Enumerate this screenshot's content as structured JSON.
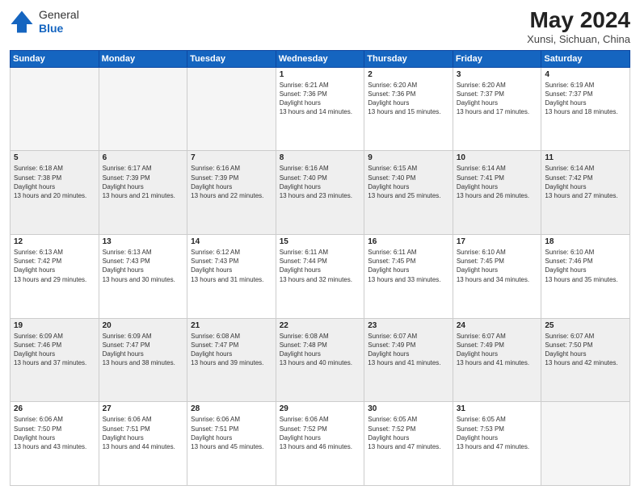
{
  "header": {
    "logo_line1": "General",
    "logo_line2": "Blue",
    "title": "May 2024",
    "subtitle": "Xunsi, Sichuan, China"
  },
  "weekdays": [
    "Sunday",
    "Monday",
    "Tuesday",
    "Wednesday",
    "Thursday",
    "Friday",
    "Saturday"
  ],
  "weeks": [
    [
      {
        "day": "",
        "empty": true
      },
      {
        "day": "",
        "empty": true
      },
      {
        "day": "",
        "empty": true
      },
      {
        "day": "1",
        "sunrise": "6:21 AM",
        "sunset": "7:36 PM",
        "daylight": "13 hours and 14 minutes."
      },
      {
        "day": "2",
        "sunrise": "6:20 AM",
        "sunset": "7:36 PM",
        "daylight": "13 hours and 15 minutes."
      },
      {
        "day": "3",
        "sunrise": "6:20 AM",
        "sunset": "7:37 PM",
        "daylight": "13 hours and 17 minutes."
      },
      {
        "day": "4",
        "sunrise": "6:19 AM",
        "sunset": "7:37 PM",
        "daylight": "13 hours and 18 minutes."
      }
    ],
    [
      {
        "day": "5",
        "sunrise": "6:18 AM",
        "sunset": "7:38 PM",
        "daylight": "13 hours and 20 minutes."
      },
      {
        "day": "6",
        "sunrise": "6:17 AM",
        "sunset": "7:39 PM",
        "daylight": "13 hours and 21 minutes."
      },
      {
        "day": "7",
        "sunrise": "6:16 AM",
        "sunset": "7:39 PM",
        "daylight": "13 hours and 22 minutes."
      },
      {
        "day": "8",
        "sunrise": "6:16 AM",
        "sunset": "7:40 PM",
        "daylight": "13 hours and 23 minutes."
      },
      {
        "day": "9",
        "sunrise": "6:15 AM",
        "sunset": "7:40 PM",
        "daylight": "13 hours and 25 minutes."
      },
      {
        "day": "10",
        "sunrise": "6:14 AM",
        "sunset": "7:41 PM",
        "daylight": "13 hours and 26 minutes."
      },
      {
        "day": "11",
        "sunrise": "6:14 AM",
        "sunset": "7:42 PM",
        "daylight": "13 hours and 27 minutes."
      }
    ],
    [
      {
        "day": "12",
        "sunrise": "6:13 AM",
        "sunset": "7:42 PM",
        "daylight": "13 hours and 29 minutes."
      },
      {
        "day": "13",
        "sunrise": "6:13 AM",
        "sunset": "7:43 PM",
        "daylight": "13 hours and 30 minutes."
      },
      {
        "day": "14",
        "sunrise": "6:12 AM",
        "sunset": "7:43 PM",
        "daylight": "13 hours and 31 minutes."
      },
      {
        "day": "15",
        "sunrise": "6:11 AM",
        "sunset": "7:44 PM",
        "daylight": "13 hours and 32 minutes."
      },
      {
        "day": "16",
        "sunrise": "6:11 AM",
        "sunset": "7:45 PM",
        "daylight": "13 hours and 33 minutes."
      },
      {
        "day": "17",
        "sunrise": "6:10 AM",
        "sunset": "7:45 PM",
        "daylight": "13 hours and 34 minutes."
      },
      {
        "day": "18",
        "sunrise": "6:10 AM",
        "sunset": "7:46 PM",
        "daylight": "13 hours and 35 minutes."
      }
    ],
    [
      {
        "day": "19",
        "sunrise": "6:09 AM",
        "sunset": "7:46 PM",
        "daylight": "13 hours and 37 minutes."
      },
      {
        "day": "20",
        "sunrise": "6:09 AM",
        "sunset": "7:47 PM",
        "daylight": "13 hours and 38 minutes."
      },
      {
        "day": "21",
        "sunrise": "6:08 AM",
        "sunset": "7:47 PM",
        "daylight": "13 hours and 39 minutes."
      },
      {
        "day": "22",
        "sunrise": "6:08 AM",
        "sunset": "7:48 PM",
        "daylight": "13 hours and 40 minutes."
      },
      {
        "day": "23",
        "sunrise": "6:07 AM",
        "sunset": "7:49 PM",
        "daylight": "13 hours and 41 minutes."
      },
      {
        "day": "24",
        "sunrise": "6:07 AM",
        "sunset": "7:49 PM",
        "daylight": "13 hours and 41 minutes."
      },
      {
        "day": "25",
        "sunrise": "6:07 AM",
        "sunset": "7:50 PM",
        "daylight": "13 hours and 42 minutes."
      }
    ],
    [
      {
        "day": "26",
        "sunrise": "6:06 AM",
        "sunset": "7:50 PM",
        "daylight": "13 hours and 43 minutes."
      },
      {
        "day": "27",
        "sunrise": "6:06 AM",
        "sunset": "7:51 PM",
        "daylight": "13 hours and 44 minutes."
      },
      {
        "day": "28",
        "sunrise": "6:06 AM",
        "sunset": "7:51 PM",
        "daylight": "13 hours and 45 minutes."
      },
      {
        "day": "29",
        "sunrise": "6:06 AM",
        "sunset": "7:52 PM",
        "daylight": "13 hours and 46 minutes."
      },
      {
        "day": "30",
        "sunrise": "6:05 AM",
        "sunset": "7:52 PM",
        "daylight": "13 hours and 47 minutes."
      },
      {
        "day": "31",
        "sunrise": "6:05 AM",
        "sunset": "7:53 PM",
        "daylight": "13 hours and 47 minutes."
      },
      {
        "day": "",
        "empty": true
      }
    ]
  ]
}
